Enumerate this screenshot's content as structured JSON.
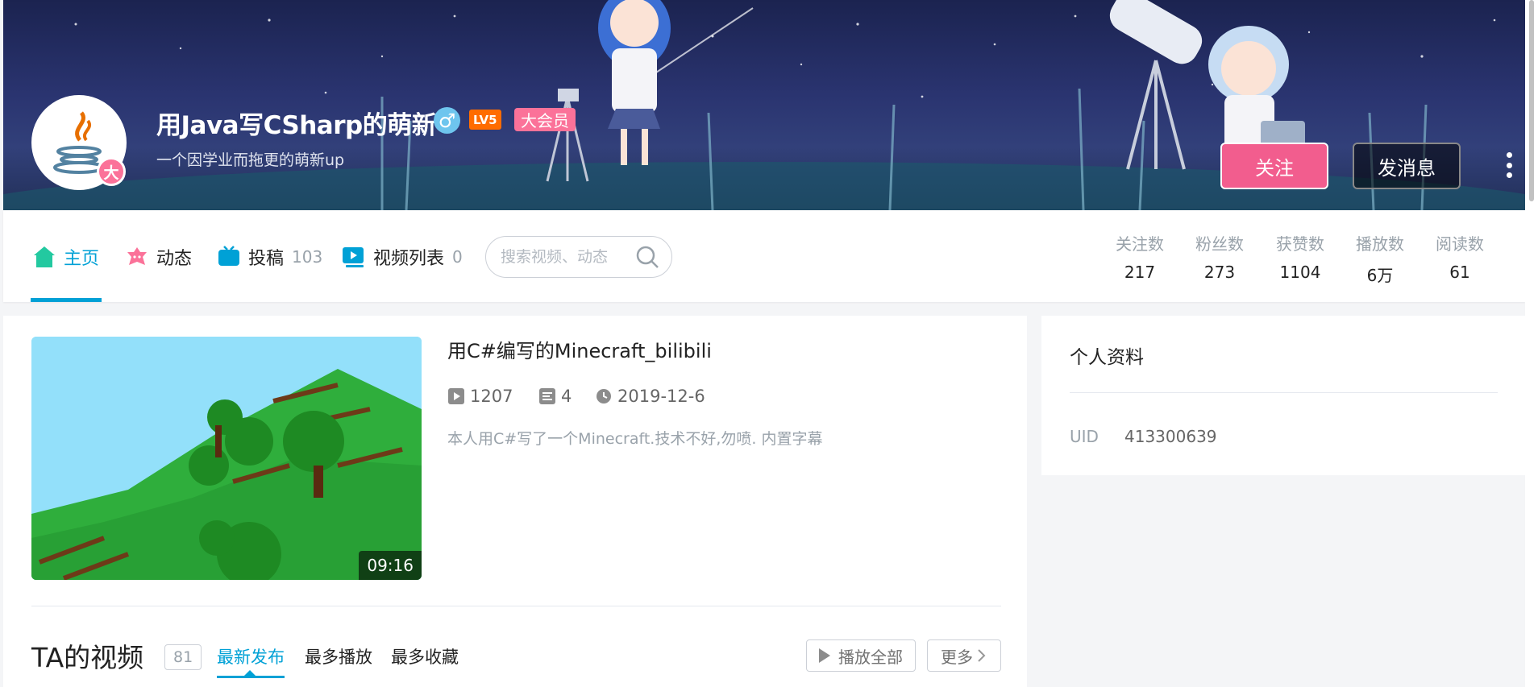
{
  "profile": {
    "name": "用Java写CSharp的萌新",
    "gender": "♂",
    "level": "LV5",
    "vip": "大会员",
    "sign": "一个因学业而拖更的萌新up",
    "avatar_badge": "大",
    "follow_label": "关注",
    "message_label": "发消息"
  },
  "nav": {
    "home": "主页",
    "dynamic": "动态",
    "posts": "投稿",
    "posts_count": "103",
    "lists": "视频列表",
    "lists_count": "0",
    "search_placeholder": "搜索视频、动态"
  },
  "stats": [
    {
      "name": "关注数",
      "value": "217"
    },
    {
      "name": "粉丝数",
      "value": "273"
    },
    {
      "name": "获赞数",
      "value": "1104"
    },
    {
      "name": "播放数",
      "value": "6万"
    },
    {
      "name": "阅读数",
      "value": "61"
    }
  ],
  "top_video": {
    "title": "用C#编写的Minecraft_bilibili",
    "plays": "1207",
    "danmaku": "4",
    "date": "2019-12-6",
    "desc": "本人用C#写了一个Minecraft.技术不好,勿喷. 内置字幕",
    "duration": "09:16"
  },
  "videos_section": {
    "title": "TA的视频",
    "count": "81",
    "tabs": [
      "最新发布",
      "最多播放",
      "最多收藏"
    ],
    "play_all": "播放全部",
    "more": "更多"
  },
  "side": {
    "title": "个人资料",
    "uid_label": "UID",
    "uid": "413300639"
  },
  "colors": {
    "accent": "#00a1d6",
    "pink": "#fb7299",
    "follow": "#f25d8e",
    "level": "#ff6c00"
  }
}
